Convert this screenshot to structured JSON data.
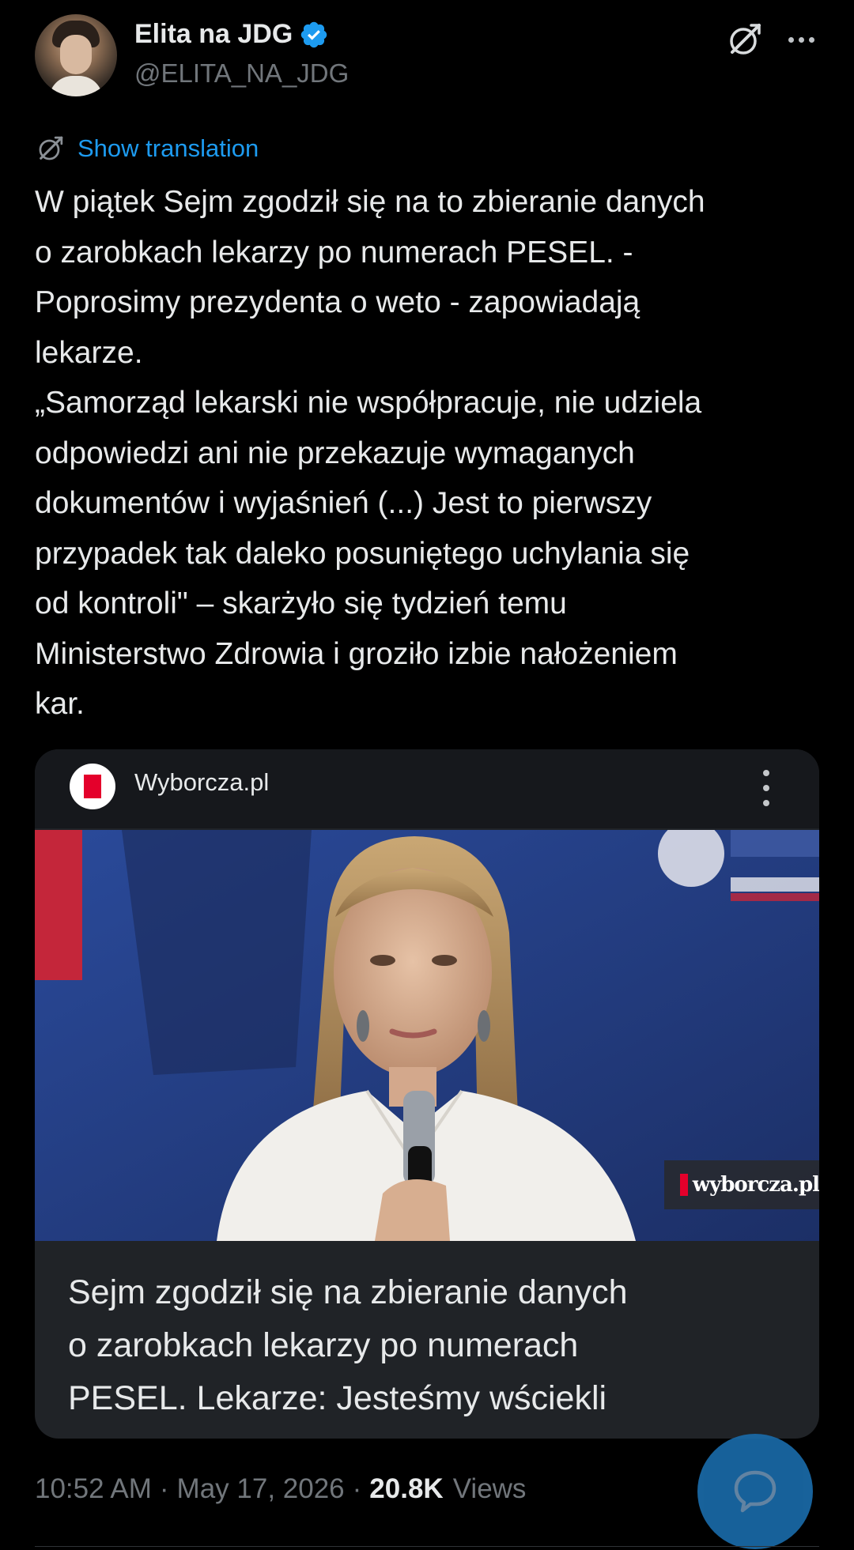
{
  "author": {
    "display_name": "Elita na JDG",
    "handle": "@ELITA_NA_JDG",
    "verified": true
  },
  "actions": {
    "translation_link": "Show translation"
  },
  "tweet": {
    "lines": [
      "W piątek Sejm zgodził się na to zbieranie danych",
      "o zarobkach lekarzy po numerach PESEL. -",
      "Poprosimy prezydenta o weto - zapowiadają",
      "lekarze.",
      "„Samorząd lekarski nie współpracuje, nie udziela",
      "odpowiedzi ani nie przekazuje wymaganych",
      "dokumentów i wyjaśnień (...) Jest to pierwszy",
      "przypadek tak daleko posuniętego uchylania się",
      "od kontroli\" – skarżyło się tydzień temu",
      "Ministerstwo Zdrowia i groziło izbie nałożeniem",
      "kar."
    ]
  },
  "link_card": {
    "site_name": "Wyborcza.pl",
    "image_watermark": "wyborcza.pl",
    "title_lines": [
      "Sejm zgodził się na zbieranie danych",
      "o zarobkach lekarzy po numerach",
      "PESEL. Lekarze: Jesteśmy wściekli"
    ]
  },
  "meta": {
    "time": "10:52 AM",
    "separator": "·",
    "date": "May 17, 2026",
    "views_count": "20.8K",
    "views_label": "Views"
  },
  "colors": {
    "background": "#000000",
    "accent": "#1d9bf0",
    "secondary_text": "#71767b",
    "brand_red": "#e4002b"
  },
  "icons": {
    "verified": "verified-badge-icon",
    "grok": "grok-icon",
    "more": "more-options-icon",
    "translate": "grok-translate-icon",
    "card_menu": "vertical-dots-icon",
    "fab": "reply-bubble-icon"
  }
}
